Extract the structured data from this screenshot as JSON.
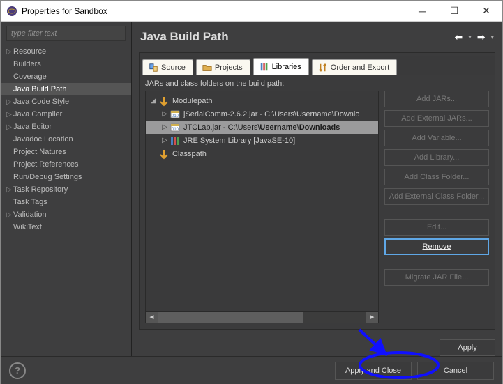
{
  "title": "Properties for Sandbox",
  "filter_placeholder": "type filter text",
  "nav": {
    "items": [
      {
        "label": "Resource",
        "expandable": true
      },
      {
        "label": "Builders",
        "expandable": false
      },
      {
        "label": "Coverage",
        "expandable": false
      },
      {
        "label": "Java Build Path",
        "expandable": false,
        "selected": true
      },
      {
        "label": "Java Code Style",
        "expandable": true
      },
      {
        "label": "Java Compiler",
        "expandable": true
      },
      {
        "label": "Java Editor",
        "expandable": true
      },
      {
        "label": "Javadoc Location",
        "expandable": false
      },
      {
        "label": "Project Natures",
        "expandable": false
      },
      {
        "label": "Project References",
        "expandable": false
      },
      {
        "label": "Run/Debug Settings",
        "expandable": false
      },
      {
        "label": "Task Repository",
        "expandable": true
      },
      {
        "label": "Task Tags",
        "expandable": false
      },
      {
        "label": "Validation",
        "expandable": true
      },
      {
        "label": "WikiText",
        "expandable": false
      }
    ]
  },
  "page": {
    "title": "Java Build Path",
    "tabs": [
      "Source",
      "Projects",
      "Libraries",
      "Order and Export"
    ],
    "active_tab": "Libraries",
    "description": "JARs and class folders on the build path:",
    "tree": {
      "root": "Modulepath",
      "items": [
        {
          "label": "jSerialComm-2.6.2.jar - C:\\Users\\Username\\Downlo",
          "icon": "jar"
        },
        {
          "label": "JTCLab.jar - C:\\Users\\Username\\Downloads",
          "icon": "jar",
          "bold_parts": [
            "Username",
            "Downloads"
          ],
          "selected": true
        },
        {
          "label": "JRE System Library [JavaSE-10]",
          "icon": "lib"
        }
      ],
      "classpath": "Classpath"
    },
    "buttons": {
      "add_jars": "Add JARs...",
      "add_external_jars": "Add External JARs...",
      "add_variable": "Add Variable...",
      "add_library": "Add Library...",
      "add_class_folder": "Add Class Folder...",
      "add_external_class_folder": "Add External Class Folder...",
      "edit": "Edit...",
      "remove": "Remove",
      "migrate": "Migrate JAR File..."
    },
    "apply": "Apply"
  },
  "footer": {
    "apply_close": "Apply and Close",
    "cancel": "Cancel"
  },
  "annot_color": "#1010ff"
}
